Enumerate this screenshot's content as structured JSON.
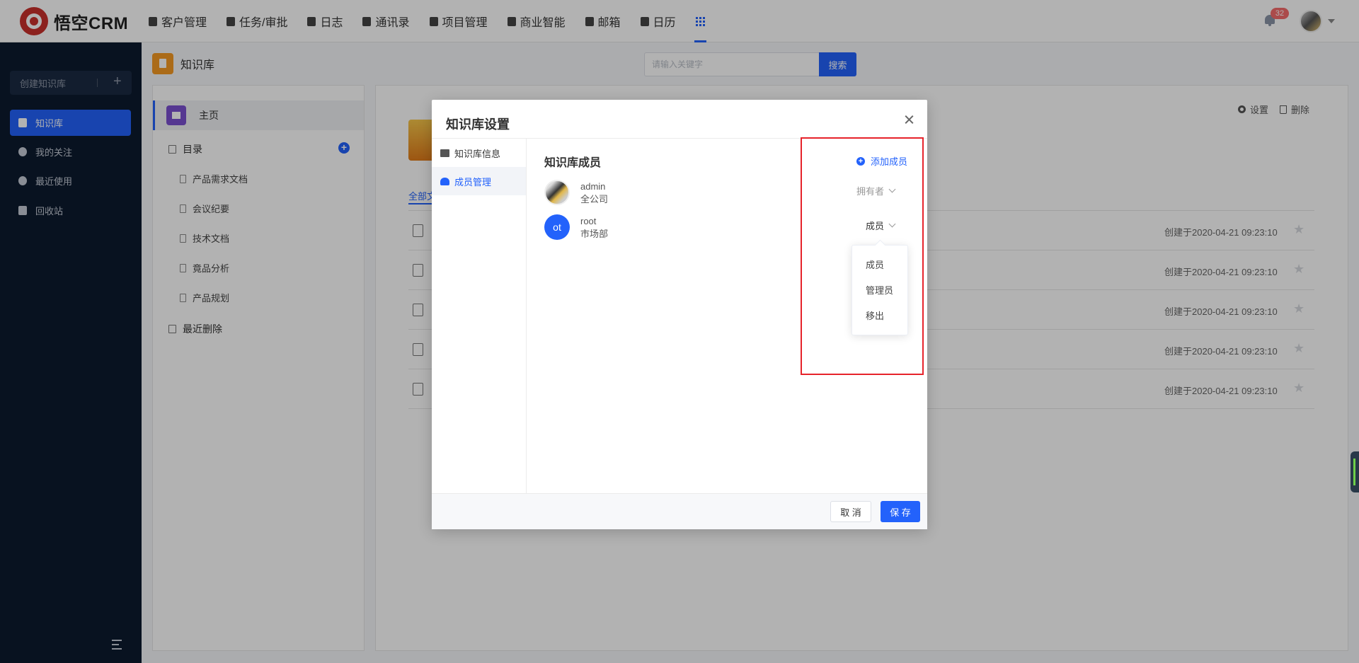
{
  "app": {
    "brand": "悟空CRM",
    "nav": [
      {
        "label": "客户管理",
        "icon": "building-icon"
      },
      {
        "label": "任务/审批",
        "icon": "briefcase-icon"
      },
      {
        "label": "日志",
        "icon": "journal-icon"
      },
      {
        "label": "通讯录",
        "icon": "phone-book-icon"
      },
      {
        "label": "项目管理",
        "icon": "project-icon"
      },
      {
        "label": "商业智能",
        "icon": "bi-shield-icon"
      },
      {
        "label": "邮箱",
        "icon": "mail-icon"
      },
      {
        "label": "日历",
        "icon": "calendar-icon"
      }
    ],
    "notification_count": "32"
  },
  "sidebar": {
    "create_label": "创建知识库",
    "items": [
      {
        "label": "知识库",
        "active": true
      },
      {
        "label": "我的关注",
        "active": false
      },
      {
        "label": "最近使用",
        "active": false
      },
      {
        "label": "回收站",
        "active": false
      }
    ]
  },
  "page": {
    "title": "知识库",
    "search_placeholder": "请输入关键字",
    "search_button": "搜索"
  },
  "tree": {
    "home": "主页",
    "catalog": "目录",
    "docs": [
      "产品需求文档",
      "会议纪要",
      "技术文档",
      "竟品分析",
      "产品规划"
    ],
    "recent_deleted": "最近删除"
  },
  "content": {
    "settings": "设置",
    "delete": "删除",
    "tab_all": "全部文",
    "rows": [
      {
        "meta": "创建于2020-04-21 09:23:10"
      },
      {
        "meta": "创建于2020-04-21 09:23:10"
      },
      {
        "meta": "创建于2020-04-21 09:23:10"
      },
      {
        "meta": "创建于2020-04-21 09:23:10"
      },
      {
        "meta": "创建于2020-04-21 09:23:10"
      }
    ]
  },
  "modal": {
    "title": "知识库设置",
    "side": [
      {
        "label": "知识库信息",
        "active": false
      },
      {
        "label": "成员管理",
        "active": true
      }
    ],
    "section_title": "知识库成员",
    "add_member": "添加成员",
    "members": [
      {
        "name": "admin",
        "dept": "全公司",
        "role": "拥有者",
        "avatar_text": ""
      },
      {
        "name": "root",
        "dept": "市场部",
        "role": "成员",
        "avatar_text": "ot"
      }
    ],
    "role_options": [
      "成员",
      "管理员",
      "移出"
    ],
    "cancel": "取 消",
    "save": "保 存"
  },
  "colors": {
    "accent": "#2362fb",
    "sidebar_bg": "#0c1a2e",
    "highlight": "#e6232b"
  }
}
